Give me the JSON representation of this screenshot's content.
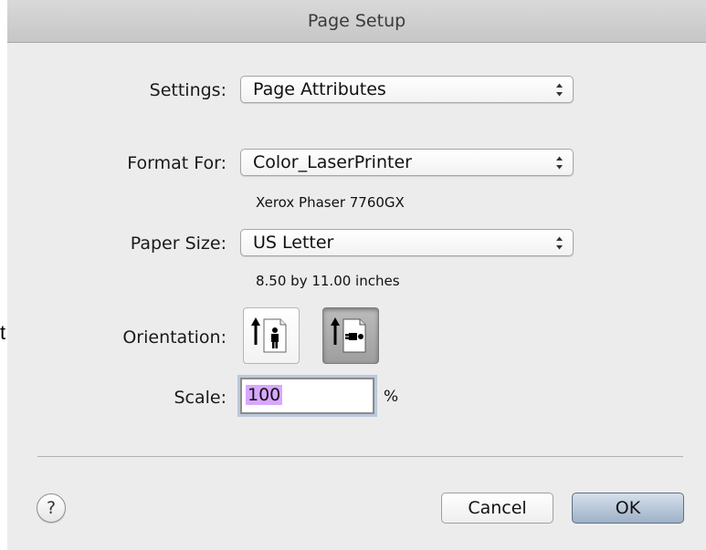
{
  "stray_text": "t",
  "dialog": {
    "title": "Page Setup"
  },
  "settings": {
    "label": "Settings:",
    "value": "Page Attributes"
  },
  "format_for": {
    "label": "Format For:",
    "value": "Color_LaserPrinter",
    "detail": "Xerox Phaser 7760GX"
  },
  "paper_size": {
    "label": "Paper Size:",
    "value": "US Letter",
    "detail": "8.50 by 11.00 inches"
  },
  "orientation": {
    "label": "Orientation:",
    "options": [
      {
        "name": "portrait",
        "icon": "portrait-orientation-icon",
        "selected": false
      },
      {
        "name": "landscape",
        "icon": "landscape-orientation-icon",
        "selected": true
      }
    ]
  },
  "scale": {
    "label": "Scale:",
    "value": "100",
    "unit": "%"
  },
  "buttons": {
    "help_label": "?",
    "cancel_label": "Cancel",
    "ok_label": "OK"
  },
  "colors": {
    "dialog_background": "#ececec",
    "default_button": "#9eb1c7",
    "selection_highlight": "#d8a7ff",
    "focus_ring": "#b9c9db"
  }
}
